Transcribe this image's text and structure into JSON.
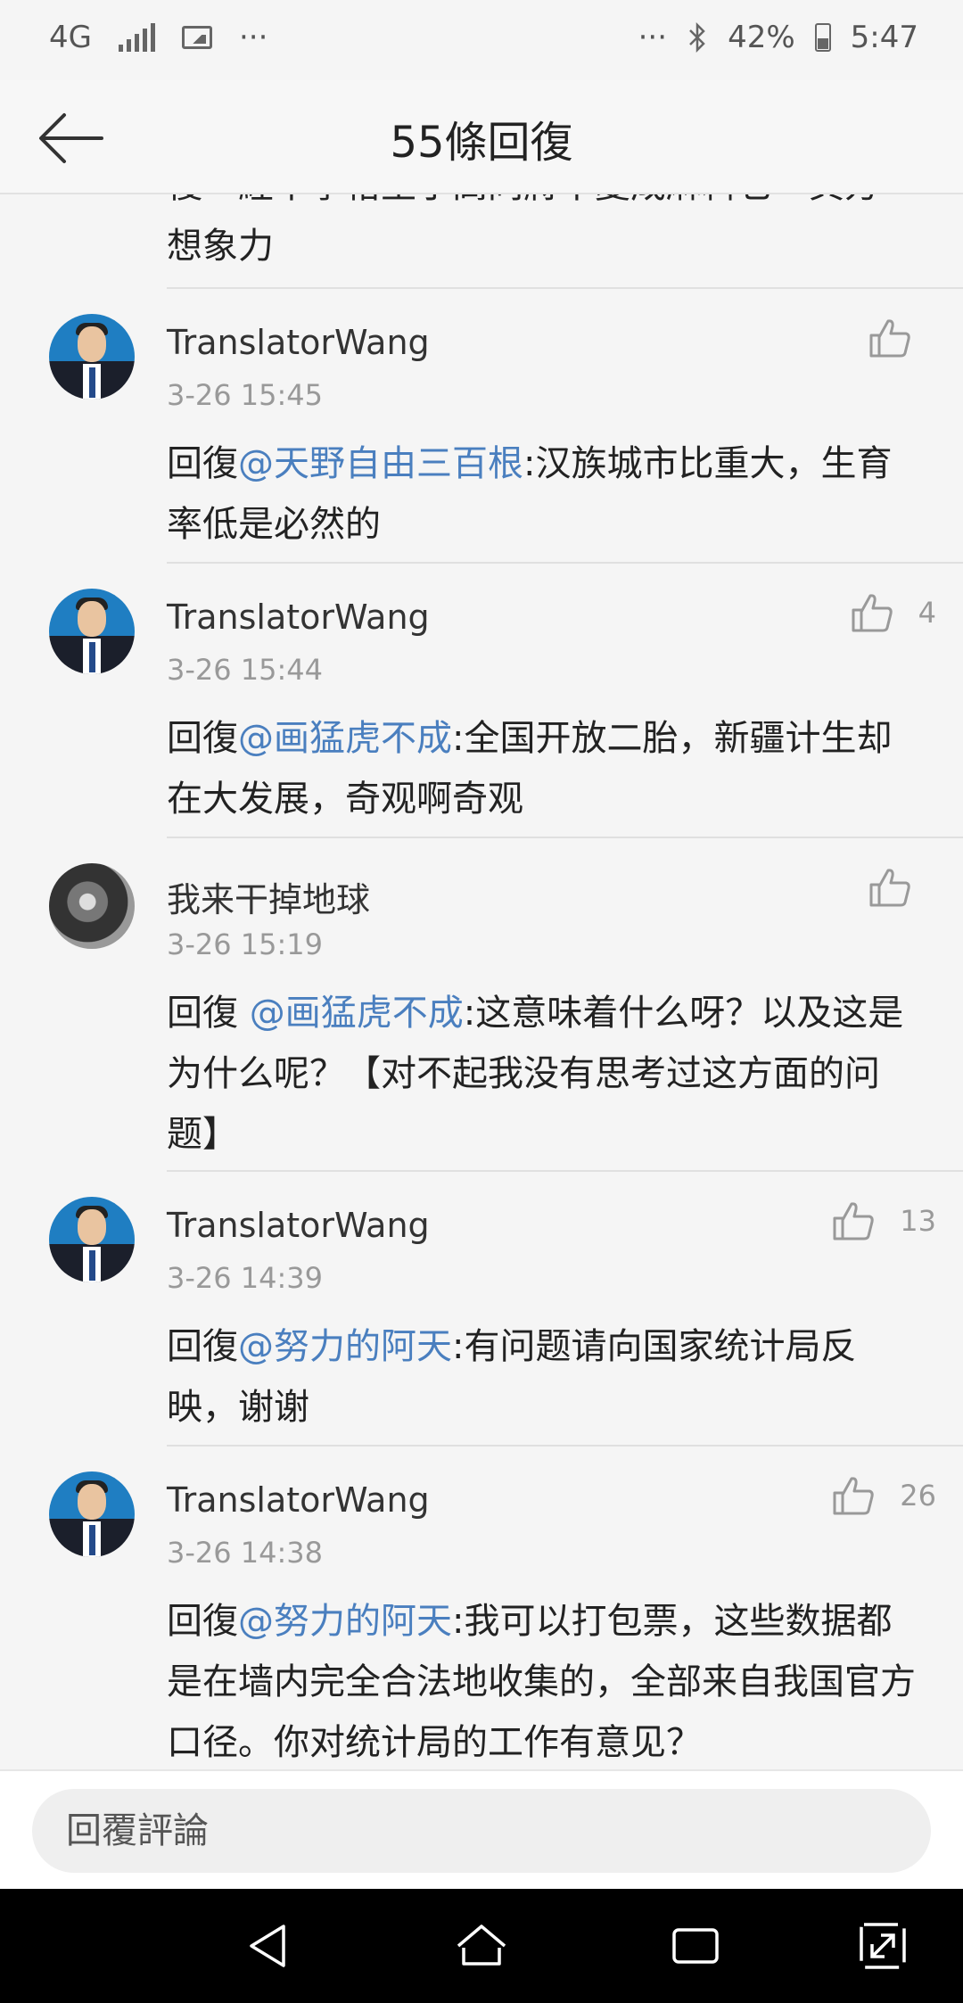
{
  "status": {
    "network": "4G",
    "overflow_left": "···",
    "overflow_right": "···",
    "battery": "42%",
    "battery_level": 0.42,
    "time": "5:47"
  },
  "header": {
    "title": "55條回復"
  },
  "partial_comment": {
    "line1": "復一經中季格生于高同將中變成麻料它一頁方",
    "line2": "想象力"
  },
  "comments": [
    {
      "user": "TranslatorWang",
      "time": "3-26 15:45",
      "likes": "",
      "prefix": "回復",
      "mention": "@天野自由三百根",
      "body": ":汉族城市比重大，生育率低是必然的"
    },
    {
      "user": "TranslatorWang",
      "time": "3-26 15:44",
      "likes": "4",
      "prefix": "回復",
      "mention": "@画猛虎不成",
      "body": ":全国开放二胎，新疆计生却在大发展，奇观啊奇观"
    },
    {
      "user": "我来干掉地球",
      "time": "3-26 15:19",
      "likes": "",
      "prefix": "回復 ",
      "mention": "@画猛虎不成",
      "body": ":这意味着什么呀？以及这是为什么呢？【对不起我没有思考过这方面的问题】"
    },
    {
      "user": "TranslatorWang",
      "time": "3-26 14:39",
      "likes": "13",
      "prefix": "回復",
      "mention": "@努力的阿天",
      "body": ":有问题请向国家统计局反映，谢谢"
    },
    {
      "user": "TranslatorWang",
      "time": "3-26 14:38",
      "likes": "26",
      "prefix": "回復",
      "mention": "@努力的阿天",
      "body": ":我可以打包票，这些数据都是在墙内完全合法地收集的，全部来自我国官方口径。你对统计局的工作有意见？"
    }
  ],
  "reply": {
    "placeholder": "回覆評論"
  },
  "colors": {
    "mention": "#4a7fbf",
    "navbar": "#000000"
  }
}
